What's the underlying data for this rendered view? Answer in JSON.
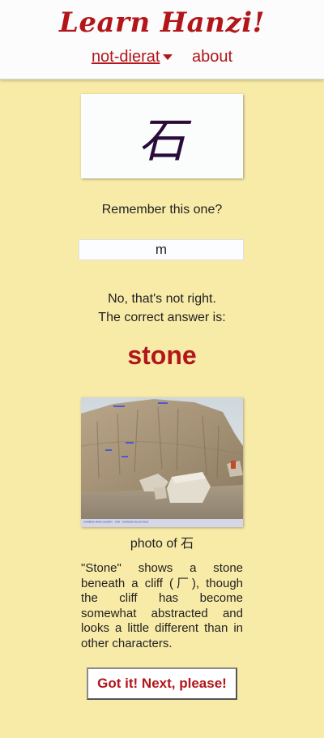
{
  "header": {
    "title": "Learn Hanzi!",
    "user_menu_label": "not-dierat",
    "about_label": "about"
  },
  "card": {
    "character": "石"
  },
  "quiz": {
    "prompt": "Remember this one?",
    "answer_value": "m",
    "feedback_line1": "No, that's not right.",
    "feedback_line2": "The correct answer is:",
    "correct_answer": "stone"
  },
  "photo": {
    "fine_print": "CAMBRIA MAIN QUARRY · SITE · EXPOSED ROCK FACE",
    "caption": "photo of 石"
  },
  "explanation": "\"Stone\" shows a stone beneath a cliff (厂), though the cliff has become somewhat abstracted and looks a little different than in other characters.",
  "actions": {
    "next_label": "Got it! Next, please!"
  },
  "colors": {
    "accent": "#b2161a",
    "background": "#f8eba8",
    "header_bg": "#fbfcfb"
  }
}
